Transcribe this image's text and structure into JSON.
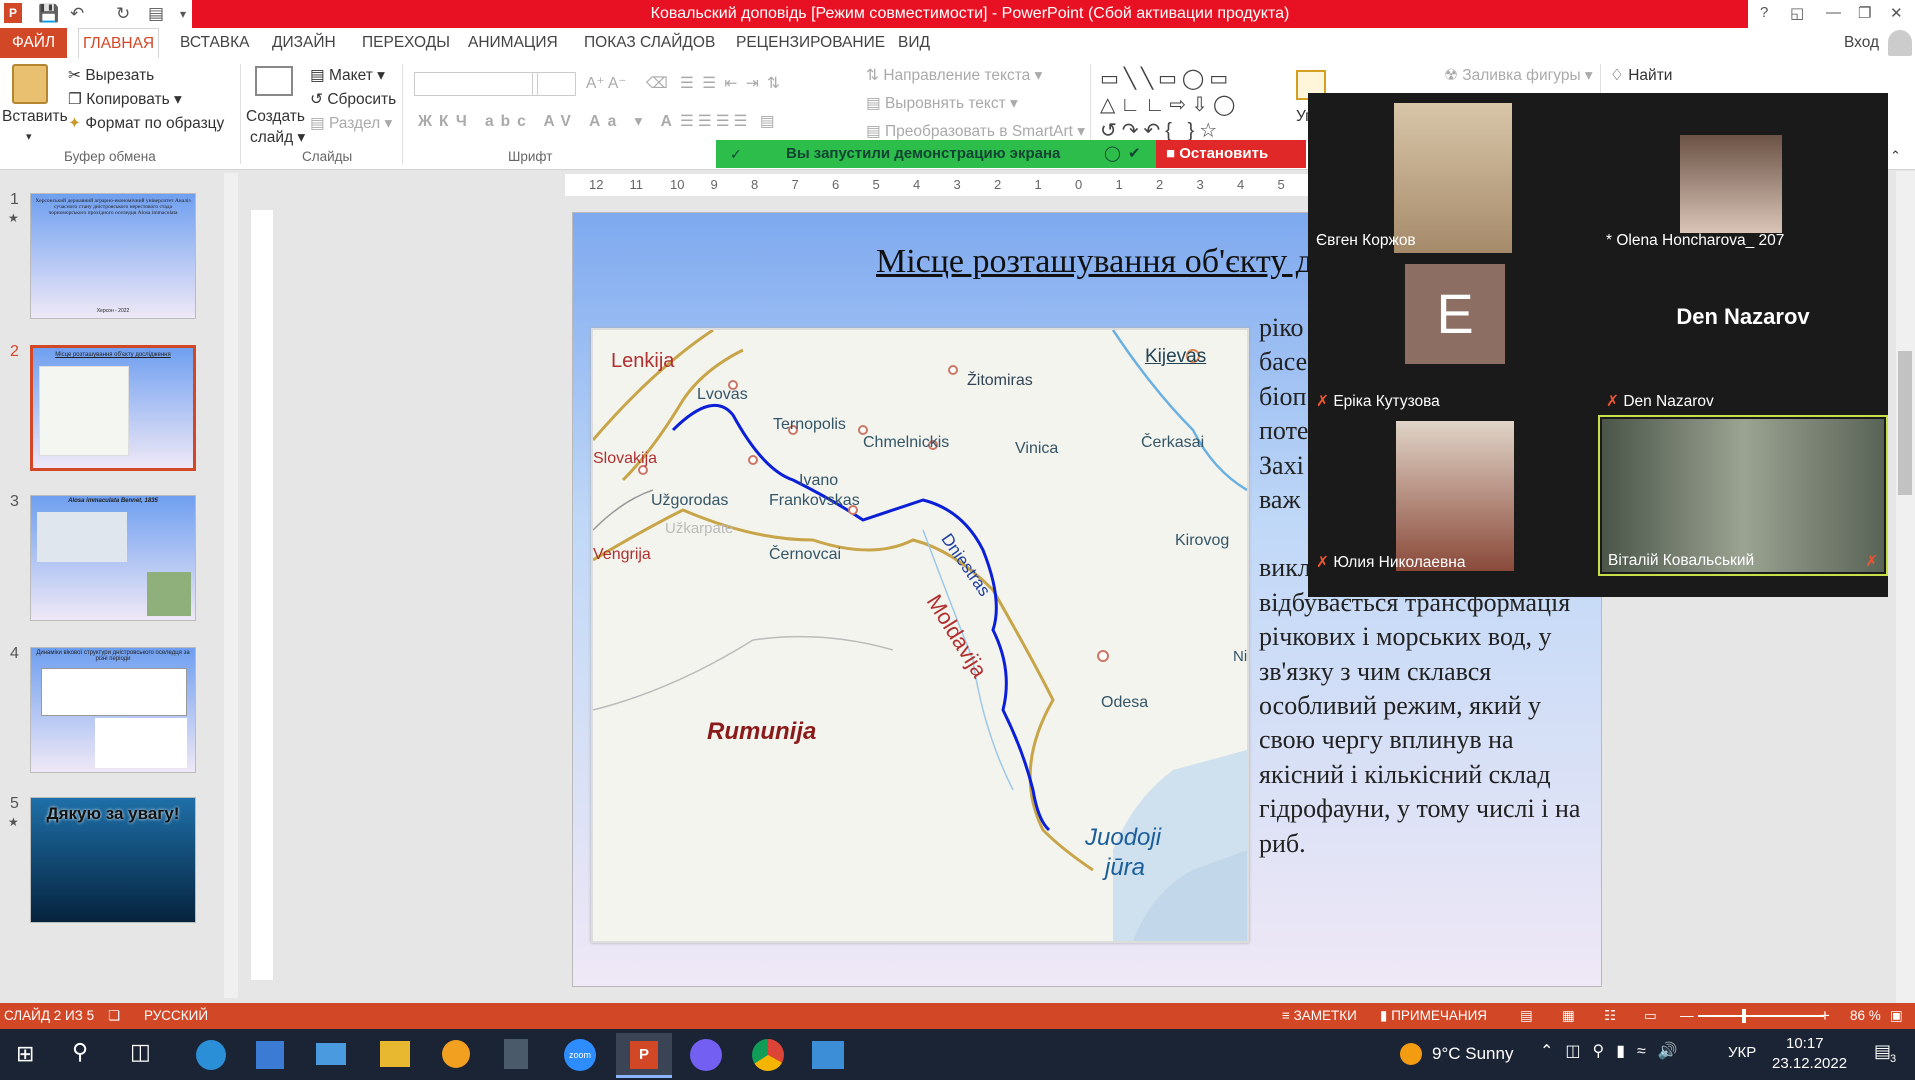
{
  "window": {
    "title": "Ковальский доповідь [Режим совместимости] - PowerPoint (Сбой активации продукта)",
    "signin": "Вход"
  },
  "ribbon_tabs": [
    "ФАЙЛ",
    "ГЛАВНАЯ",
    "ВСТАВКА",
    "ДИЗАЙН",
    "ПЕРЕХОДЫ",
    "АНИМАЦИЯ",
    "ПОКАЗ СЛАЙДОВ",
    "РЕЦЕНЗИРОВАНИЕ",
    "ВИД"
  ],
  "ribbon": {
    "paste": "Вставить",
    "cut": "Вырезать",
    "copy": "Копировать",
    "format_painter": "Формат по образцу",
    "group_clipboard": "Буфер обмена",
    "new_slide": "Создать",
    "new_slide2": "слайд",
    "layout": "Макет",
    "reset": "Сбросить",
    "section": "Раздел",
    "group_slides": "Слайды",
    "group_font": "Шрифт",
    "text_direction": "Направление текста",
    "align_text": "Выровнять текст",
    "smartart": "Преобразовать в SmartArt",
    "arrange": "Упор",
    "shape_fill": "Заливка фигуры",
    "find": "Найти"
  },
  "share_bar": {
    "message": "Вы запустили демонстрацию экрана",
    "stop": "Остановить совм"
  },
  "ruler_ticks": [
    "12",
    "11",
    "10",
    "9",
    "8",
    "7",
    "6",
    "5",
    "4",
    "3",
    "2",
    "1",
    "0",
    "1",
    "2",
    "3",
    "4",
    "5"
  ],
  "thumbnails": [
    {
      "num": "1",
      "star": true,
      "text": "Херсонський державний аграрно-економічний університет Аналіз сучасного стану дністровського нерестового стада чорноморського прохідного оселедця Alosa immaculata",
      "footer": "Херсон - 2022"
    },
    {
      "num": "2",
      "star": false,
      "text": "Місце розташування об'єкту дослідження"
    },
    {
      "num": "3",
      "star": false,
      "text": "Alosa immaculata Bennet, 1835"
    },
    {
      "num": "4",
      "star": false,
      "text": "Динаміки вікової структури дністровського оселедця за різні періоди"
    },
    {
      "num": "5",
      "star": true,
      "text": "Дякую за увагу!"
    }
  ],
  "slide": {
    "title": "Місце розташування об'єкту до",
    "text_partial": [
      "ріко",
      "басе",
      "біоп",
      "поте",
      "Захі",
      "важ"
    ],
    "text_full": "викликає пониззя Дністра. Тут відбувається трансформація річкових і морських вод, у зв'язку з чим склався особливий режим, який у свою чергу вплинув на якісний і кількісний склад гідрофауни, у тому числі і на риб."
  },
  "map_labels": {
    "lenkija": "Lenkija",
    "kijevas": "Kijevas",
    "zitomiras": "Žitomiras",
    "lvovas": "Lvovas",
    "ternopolis": "Ternopolis",
    "chmelnickis": "Chmelnickis",
    "vinica": "Vinica",
    "cerkasai": "Čerkasai",
    "slovakija": "Slovakija",
    "ivano": "Ivano",
    "frankovskas": "Frankovskas",
    "uzgorodas": "Užgorodas",
    "uzkarpate": "Užkarpate",
    "vengrija": "Vengrija",
    "cernovcai": "Černovcai",
    "dniestras": "Dniestras",
    "kirovog": "Kirovog",
    "moldavija": "Moldavija",
    "ni": "Ni",
    "odesa": "Odesa",
    "rumunija": "Rumunija",
    "juodoji": "Juodoji",
    "jura": "jūra"
  },
  "zoom": {
    "participants": [
      {
        "name": "Євген Коржов",
        "muted": false,
        "type": "video"
      },
      {
        "name": "* Olena Honcharova_ 207",
        "muted": false,
        "type": "video"
      },
      {
        "name": "Еріка Кутузова",
        "muted": true,
        "type": "avatar",
        "initial": "E"
      },
      {
        "name": "Den Nazarov",
        "muted": true,
        "type": "name",
        "display": "Den Nazarov"
      },
      {
        "name": "Юлия Николаевна",
        "muted": true,
        "type": "video"
      },
      {
        "name": "Віталій Ковальський",
        "muted": true,
        "type": "video",
        "active": true
      }
    ]
  },
  "statusbar": {
    "slide": "СЛАЙД 2 ИЗ 5",
    "lang": "РУССКИЙ",
    "notes": "ЗАМЕТКИ",
    "comments": "ПРИМЕЧАНИЯ",
    "zoom": "86 %"
  },
  "taskbar": {
    "weather": "9°C  Sunny",
    "lang": "УКР",
    "time": "10:17",
    "date": "23.12.2022",
    "notif": "3",
    "zoom_app": "zoom"
  },
  "colors": {
    "accent": "#d24726",
    "title_red": "#e81123",
    "share_green": "#2dbd4b",
    "river": "#0a1fd6"
  }
}
